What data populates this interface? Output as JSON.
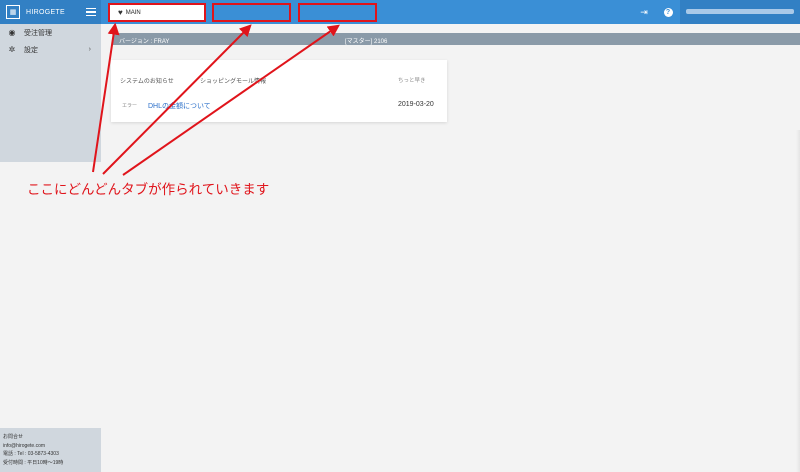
{
  "app": {
    "name": "HIROGETE"
  },
  "tabs": [
    {
      "label": "MAIN",
      "icon": "heart-icon"
    },
    {
      "label": ""
    },
    {
      "label": ""
    }
  ],
  "header": {
    "export_icon": "export-icon",
    "help_icon": "help-icon"
  },
  "sidebar": {
    "items": [
      {
        "label": "受注管理",
        "icon": "globe-icon"
      },
      {
        "label": "設定",
        "icon": "gear-icon",
        "has_submenu": true
      }
    ],
    "footer": {
      "title": "お問合せ",
      "email": "info@hirogete.com",
      "phone": "電話 : Tel : 03-5873-4303",
      "hours": "受付時間 : 平日10時〜19時"
    }
  },
  "info_bar": {
    "version": "バージョン : FRAY",
    "master": "[マスター] 2106"
  },
  "news": {
    "tabs": [
      "システムのお知らせ",
      "ショッピングモール情報"
    ],
    "column_label": "ちっと早き",
    "items": [
      {
        "category": "エラー",
        "title": "DHLの金額について",
        "date": "2019-03-20"
      }
    ]
  },
  "annotation": {
    "text": "ここにどんどんタブが作られていきます"
  },
  "colors": {
    "header": "#3a8fd6",
    "annotation": "#e0141b",
    "sidebar": "#d0d7de",
    "link": "#2a6fc9"
  }
}
